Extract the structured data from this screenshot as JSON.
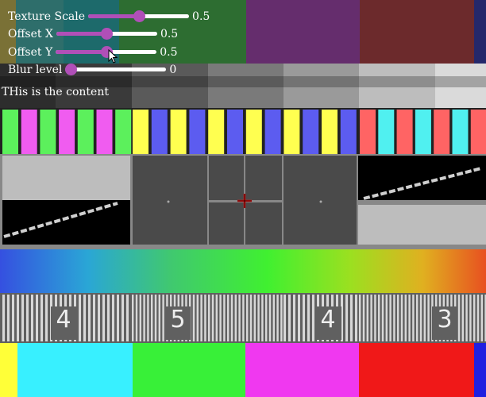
{
  "controls": [
    {
      "label": "Texture Scale",
      "value": "0.5",
      "fraction": 0.5
    },
    {
      "label": "Offset X",
      "value": "0.5",
      "fraction": 0.5
    },
    {
      "label": "Offset Y",
      "value": "0.5",
      "fraction": 0.5
    },
    {
      "label": "Blur level",
      "value": "0",
      "fraction": 0.0
    }
  ],
  "content_text": "THis is the content",
  "test_pattern": {
    "block_numbers": [
      "4",
      "5",
      "4",
      "3"
    ]
  },
  "colors": {
    "slider_accent": "#b04fb8",
    "track": "#ffffff",
    "text": "#ffffff"
  }
}
